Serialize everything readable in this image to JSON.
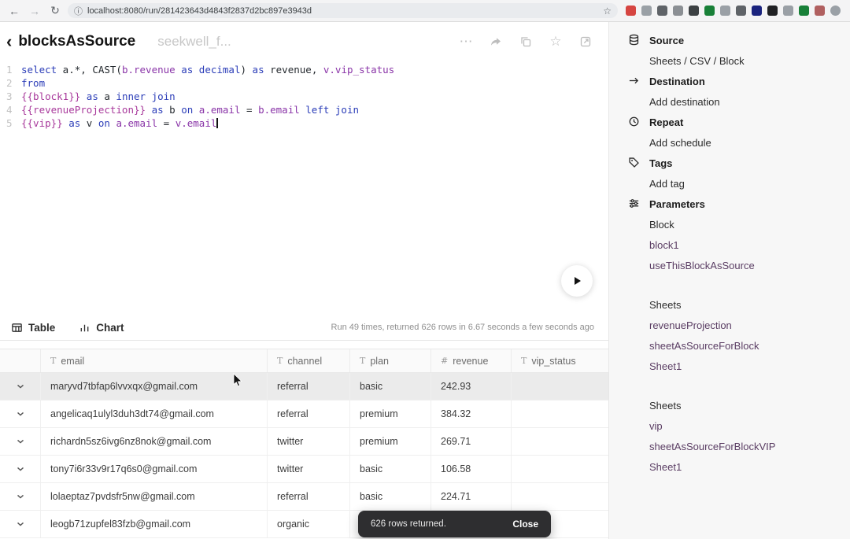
{
  "browser": {
    "url": "localhost:8080/run/281423643d4843f2837d2bc897e3943d",
    "extension_colors": [
      "#d64541",
      "#9aa0a6",
      "#5f6368",
      "#8b8f94",
      "#3c4043",
      "#188038",
      "#9aa0a6",
      "#5f6368",
      "#1a237e",
      "#202124",
      "#9aa0a6",
      "#188038",
      "#b06060",
      "#9aa0a6"
    ]
  },
  "header": {
    "back_icon": "‹",
    "title": "blocksAsSource",
    "subtitle": "seekwell_f..."
  },
  "editor": {
    "lines": [
      {
        "num": "1",
        "segments": [
          {
            "t": "select",
            "c": "kw"
          },
          {
            "t": " a.*, ",
            "c": "id"
          },
          {
            "t": "CAST(",
            "c": "id"
          },
          {
            "t": "b.revenue",
            "c": "ref"
          },
          {
            "t": " as decimal",
            "c": "kw"
          },
          {
            "t": ") ",
            "c": "id"
          },
          {
            "t": "as",
            "c": "kw"
          },
          {
            "t": " revenue, ",
            "c": "id"
          },
          {
            "t": "v.vip_status",
            "c": "ref"
          }
        ]
      },
      {
        "num": "2",
        "segments": [
          {
            "t": "from",
            "c": "kw"
          }
        ]
      },
      {
        "num": "3",
        "segments": [
          {
            "t": "{{block1}}",
            "c": "tv"
          },
          {
            "t": " as",
            "c": "kw"
          },
          {
            "t": " a ",
            "c": "id"
          },
          {
            "t": "inner join",
            "c": "kw"
          }
        ]
      },
      {
        "num": "4",
        "segments": [
          {
            "t": "{{revenueProjection}}",
            "c": "tv"
          },
          {
            "t": " as",
            "c": "kw"
          },
          {
            "t": " b ",
            "c": "id"
          },
          {
            "t": "on",
            "c": "kw"
          },
          {
            "t": " ",
            "c": "id"
          },
          {
            "t": "a.email",
            "c": "ref"
          },
          {
            "t": " = ",
            "c": "id"
          },
          {
            "t": "b.email",
            "c": "ref"
          },
          {
            "t": " left join",
            "c": "kw"
          }
        ]
      },
      {
        "num": "5",
        "caret": true,
        "segments": [
          {
            "t": "{{vip}}",
            "c": "tv"
          },
          {
            "t": " as",
            "c": "kw"
          },
          {
            "t": " v ",
            "c": "id"
          },
          {
            "t": "on",
            "c": "kw"
          },
          {
            "t": " ",
            "c": "id"
          },
          {
            "t": "a.email",
            "c": "ref"
          },
          {
            "t": " = ",
            "c": "id"
          },
          {
            "t": "v.email",
            "c": "ref"
          }
        ]
      }
    ]
  },
  "results": {
    "tabs": [
      {
        "label": "Table",
        "icon": "table-icon"
      },
      {
        "label": "Chart",
        "icon": "chart-icon"
      }
    ],
    "status": "Run 49 times, returned 626 rows in 6.67 seconds a few seconds ago",
    "columns": [
      {
        "icon": "T",
        "label": "email"
      },
      {
        "icon": "T",
        "label": "channel"
      },
      {
        "icon": "T",
        "label": "plan"
      },
      {
        "icon": "#",
        "label": "revenue"
      },
      {
        "icon": "T",
        "label": "vip_status"
      }
    ],
    "rows": [
      {
        "email": "maryvd7tbfap6lvvxqx@gmail.com",
        "channel": "referral",
        "plan": "basic",
        "revenue": "242.93",
        "vip_status": "",
        "highlighted": true
      },
      {
        "email": "angelicaq1ulyl3duh3dt74@gmail.com",
        "channel": "referral",
        "plan": "premium",
        "revenue": "384.32",
        "vip_status": "",
        "highlighted": false
      },
      {
        "email": "richardn5sz6ivg6nz8nok@gmail.com",
        "channel": "twitter",
        "plan": "premium",
        "revenue": "269.71",
        "vip_status": "",
        "highlighted": false
      },
      {
        "email": "tony7i6r33v9r17q6s0@gmail.com",
        "channel": "twitter",
        "plan": "basic",
        "revenue": "106.58",
        "vip_status": "",
        "highlighted": false
      },
      {
        "email": "lolaeptaz7pvdsfr5nw@gmail.com",
        "channel": "referral",
        "plan": "basic",
        "revenue": "224.71",
        "vip_status": "",
        "highlighted": false
      },
      {
        "email": "leogb71zupfel83fzb@gmail.com",
        "channel": "organic",
        "plan": "",
        "revenue": "",
        "vip_status": "",
        "highlighted": false
      }
    ]
  },
  "toast": {
    "message": "626 rows returned.",
    "close_label": "Close"
  },
  "sidebar": {
    "items": [
      {
        "type": "header",
        "icon": "database-icon",
        "label": "Source"
      },
      {
        "type": "action",
        "label": "Sheets / CSV / Block"
      },
      {
        "type": "header",
        "icon": "arrow-right-icon",
        "label": "Destination"
      },
      {
        "type": "action",
        "label": "Add destination"
      },
      {
        "type": "header",
        "icon": "clock-icon",
        "label": "Repeat"
      },
      {
        "type": "action",
        "label": "Add schedule"
      },
      {
        "type": "header",
        "icon": "tag-icon",
        "label": "Tags"
      },
      {
        "type": "action",
        "label": "Add tag"
      },
      {
        "type": "header",
        "icon": "sliders-icon",
        "label": "Parameters"
      },
      {
        "type": "group",
        "label": "Block"
      },
      {
        "type": "link",
        "label": "block1"
      },
      {
        "type": "link",
        "label": "useThisBlockAsSource"
      },
      {
        "type": "spacer"
      },
      {
        "type": "group",
        "label": "Sheets"
      },
      {
        "type": "link",
        "label": "revenueProjection"
      },
      {
        "type": "link",
        "label": "sheetAsSourceForBlock"
      },
      {
        "type": "link",
        "label": "Sheet1"
      },
      {
        "type": "spacer"
      },
      {
        "type": "group",
        "label": "Sheets"
      },
      {
        "type": "link",
        "label": "vip"
      },
      {
        "type": "link",
        "label": "sheetAsSourceForBlockVIP"
      },
      {
        "type": "link",
        "label": "Sheet1"
      }
    ]
  }
}
